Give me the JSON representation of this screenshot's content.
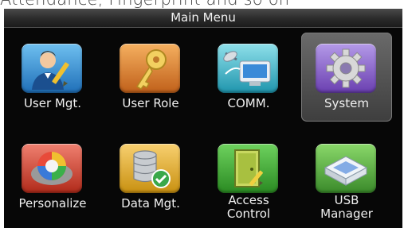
{
  "caption": "Attendance, Fingerprint and so on",
  "header": {
    "title": "Main Menu"
  },
  "menu": [
    {
      "label": "User Mgt.",
      "icon": "user-edit-icon",
      "color": "#2a82c8"
    },
    {
      "label": "User Role",
      "icon": "key-icon",
      "color": "#d9781a"
    },
    {
      "label": "COMM.",
      "icon": "network-computer-icon",
      "color": "#1a9ab0"
    },
    {
      "label": "System",
      "icon": "gear-icon",
      "color": "#7b4fc0",
      "selected": true
    },
    {
      "label": "Personalize",
      "icon": "color-wheel-icon",
      "color": "#c83a2a"
    },
    {
      "label": "Data Mgt.",
      "icon": "database-check-icon",
      "color": "#d8a020"
    },
    {
      "label_line1": "Access",
      "label_line2": "Control",
      "icon": "door-icon",
      "color": "#3a9a30"
    },
    {
      "label_line1": "USB",
      "label_line2": "Manager",
      "icon": "usb-drive-icon",
      "color": "#4a9a3a"
    }
  ]
}
